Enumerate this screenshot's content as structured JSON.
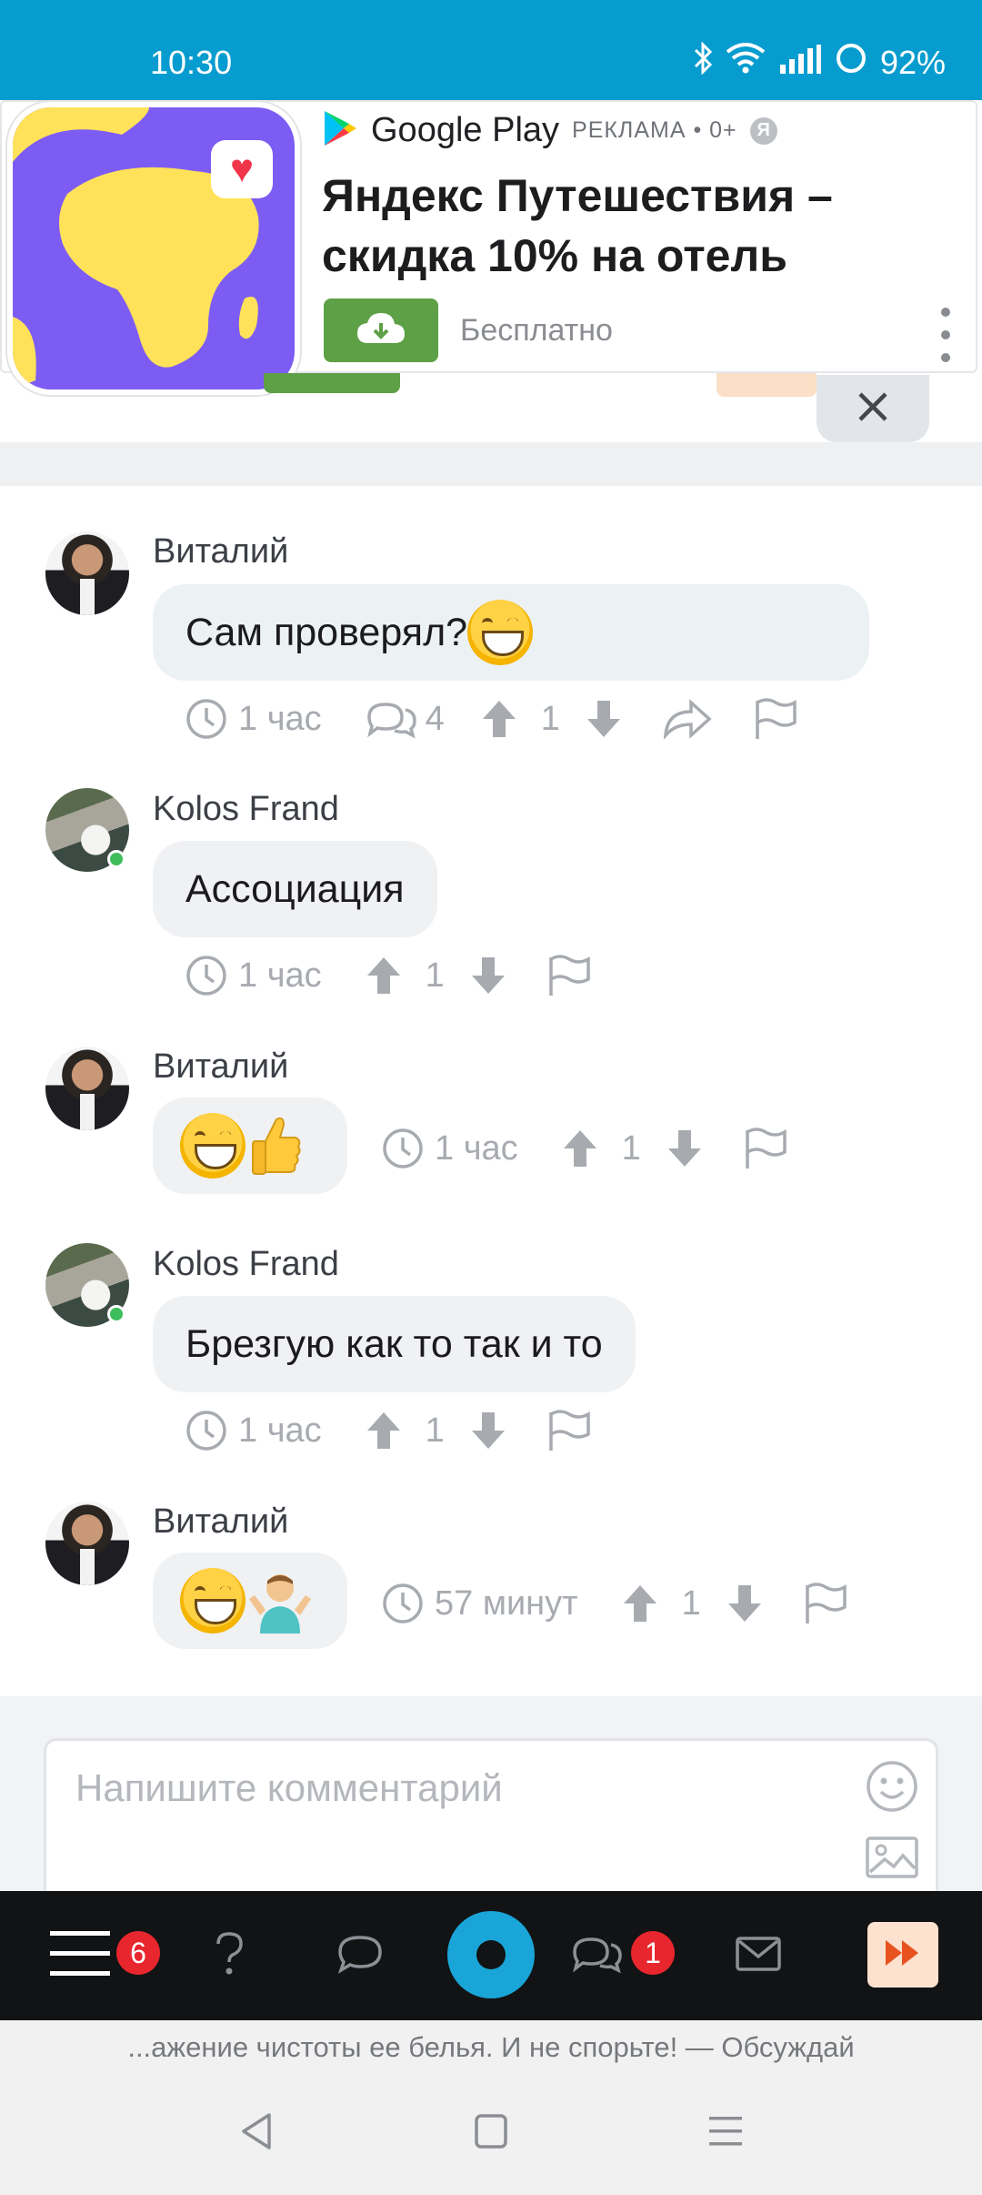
{
  "status_bar": {
    "time": "10:30",
    "battery": "92%",
    "icons": [
      "bluetooth-icon",
      "wifi-icon",
      "signal-icon",
      "battery-icon"
    ]
  },
  "ad": {
    "store": "Google Play",
    "tag": "РЕКЛАМА • 0+",
    "title": "Яндекс Путешествия – скидка 10% на отель",
    "price": "Бесплатно",
    "colors": {
      "image_bg": "#7d5cf3",
      "continent": "#ffe259",
      "install_button": "#5ea045"
    }
  },
  "comments": [
    {
      "author": "Виталий",
      "text": "Сам проверял?",
      "emoji": [
        "grinning-face"
      ],
      "time": "1 час",
      "replies": "4",
      "rating": "1"
    },
    {
      "author": "Kolos Frand",
      "text": "Ассоциация",
      "time": "1 час",
      "rating": "1",
      "online": true
    },
    {
      "author": "Виталий",
      "text": "",
      "emoji": [
        "grinning-face",
        "thumbs-up"
      ],
      "time": "1 час",
      "rating": "1"
    },
    {
      "author": "Kolos Frand",
      "text": "Брезгую как то так и то",
      "time": "1 час",
      "rating": "1",
      "online": true
    },
    {
      "author": "Виталий",
      "text": "",
      "emoji": [
        "grinning-face",
        "person-shrugging"
      ],
      "time": "57 минут",
      "rating": "1"
    }
  ],
  "comment_input": {
    "placeholder": "Напишите комментарий"
  },
  "bottom_nav": {
    "menu_badge": "6",
    "messages_badge": "1",
    "accent": "#1aa5d8"
  },
  "ticker": "...ажение чистоты ее белья. И не спорьте! — Обсуждай"
}
